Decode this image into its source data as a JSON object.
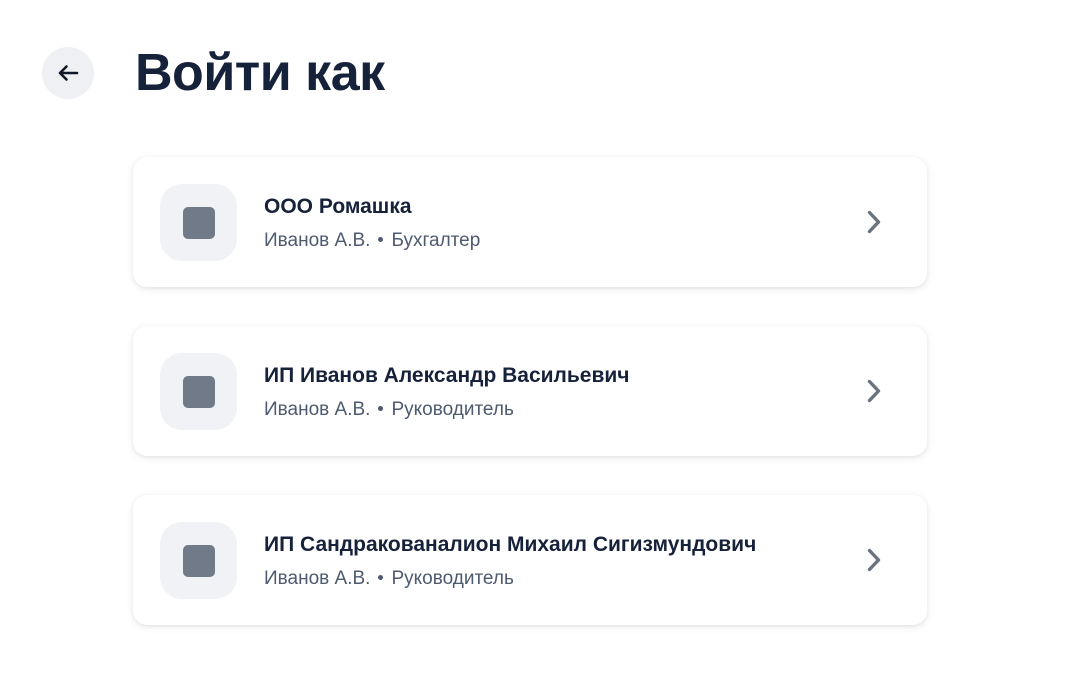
{
  "header": {
    "title": "Войти как",
    "back_icon": "arrow-left-icon"
  },
  "accounts": [
    {
      "name": "ООО Ромашка",
      "person": "Иванов А.В.",
      "role": "Бухгалтер",
      "avatar_icon": "company-placeholder-icon",
      "chevron_icon": "chevron-right-icon"
    },
    {
      "name": "ИП Иванов Александр Васильевич",
      "person": "Иванов А.В.",
      "role": "Руководитель",
      "avatar_icon": "company-placeholder-icon",
      "chevron_icon": "chevron-right-icon"
    },
    {
      "name": "ИП Сандракованалион Михаил Сигизмундович",
      "person": "Иванов А.В.",
      "role": "Руководитель",
      "avatar_icon": "company-placeholder-icon",
      "chevron_icon": "chevron-right-icon"
    }
  ],
  "colors": {
    "title": "#16213a",
    "subtitle": "#4d5a70",
    "avatar_bg": "#f0f2f5",
    "avatar_fg": "#717a88",
    "chevron": "#6b7280",
    "back_bg": "#eef0f3"
  }
}
